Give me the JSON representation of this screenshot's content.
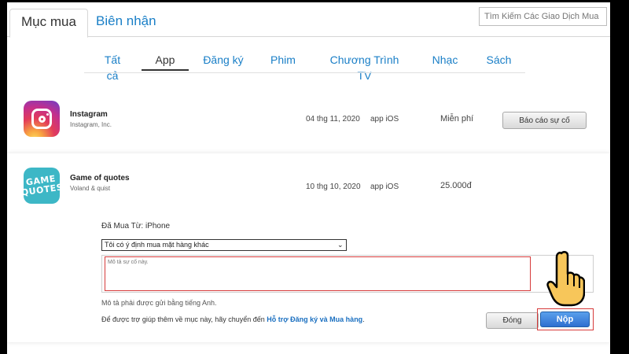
{
  "header": {
    "tabs": [
      {
        "label": "Mục mua",
        "active": true
      },
      {
        "label": "Biên nhận",
        "active": false
      }
    ],
    "search_placeholder": "Tìm Kiếm Các Giao Dịch Mua H"
  },
  "categories": [
    "Tất cả",
    "App",
    "Đăng ký",
    "Phim",
    "Chương Trình TV",
    "Nhạc",
    "Sách"
  ],
  "active_category": "App",
  "purchases": [
    {
      "name": "Instagram",
      "developer": "Instagram, Inc.",
      "date": "04 thg 11, 2020",
      "kind": "app iOS",
      "price": "Miễn phí",
      "action_label": "Báo cáo sự cố",
      "icon": "instagram-icon"
    },
    {
      "name": "Game of quotes",
      "developer": "Voland & quist",
      "date": "10 thg 10, 2020",
      "kind": "app iOS",
      "price": "25.000đ",
      "icon_text": "GAME QUOTES",
      "icon": "game-of-quotes-icon"
    }
  ],
  "report_form": {
    "purchased_from": "Đã Mua Từ: iPhone",
    "selected_reason": "Tôi có ý định mua mặt hàng khác",
    "description_placeholder": "Mô tả sự cố này.",
    "english_note": "Mô tả phải được gửi bằng tiếng Anh.",
    "help_prefix": "Để được trợ giúp thêm về mục này, hãy chuyển đến ",
    "help_link": "Hỗ trợ Đăng ký và Mua hàng",
    "help_suffix": ".",
    "close_label": "Đóng",
    "submit_label": "Nộp"
  },
  "colors": {
    "link": "#1a7fc7",
    "highlight": "#d63a3a",
    "submit": "#2e6fd0"
  }
}
